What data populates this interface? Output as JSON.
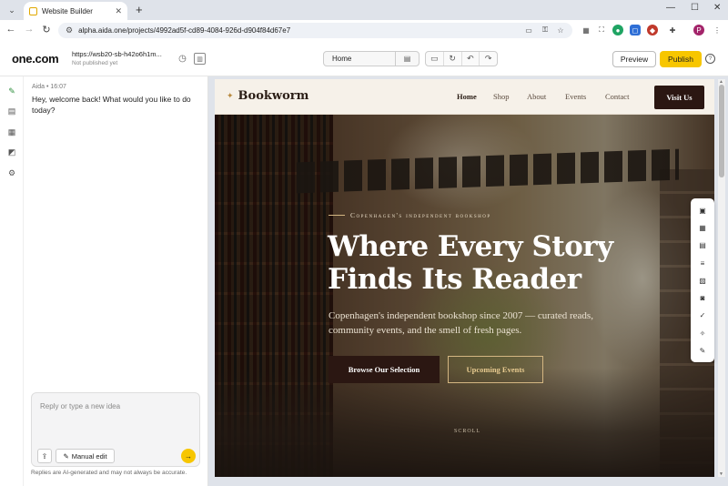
{
  "browser": {
    "tab_title": "Website Builder",
    "tab_close": "✕",
    "new_tab": "+",
    "url": "alpha.aida.one/projects/4992ad5f-cd89-4084-926d-d904f84d67e7",
    "profile_initial": "P",
    "win_min": "—",
    "win_max": "☐",
    "win_close": "✕"
  },
  "toolbar": {
    "logo": "one.com",
    "site_url": "https://wsb20-sb-h42o6h1m...",
    "site_status": "Not published yet",
    "page_select": "Home",
    "preview_label": "Preview",
    "publish_label": "Publish"
  },
  "chat": {
    "sender": "Aida",
    "time": "16:07",
    "message": "Hey, welcome back! What would you like to do today?",
    "input_placeholder": "Reply or type a new idea",
    "manual_edit_label": "Manual edit",
    "disclaimer": "Replies are AI-generated and may not always be accurate."
  },
  "site": {
    "brand": "Bookworm",
    "nav": [
      "Home",
      "Shop",
      "About",
      "Events",
      "Contact"
    ],
    "visit_label": "Visit Us",
    "eyebrow": "Copenhagen's independent bookshop",
    "headline_1": "Where Every Story",
    "headline_2": "Finds Its Reader",
    "subtext": "Copenhagen's independent bookshop since 2007 — curated reads, community events, and the smell of fresh pages.",
    "cta_primary": "Browse Our Selection",
    "cta_secondary": "Upcoming Events",
    "scroll_label": "SCROLL"
  },
  "colors": {
    "publish": "#f7c600",
    "brand_dark": "#2b1712",
    "accent_gold": "#d4b682"
  }
}
